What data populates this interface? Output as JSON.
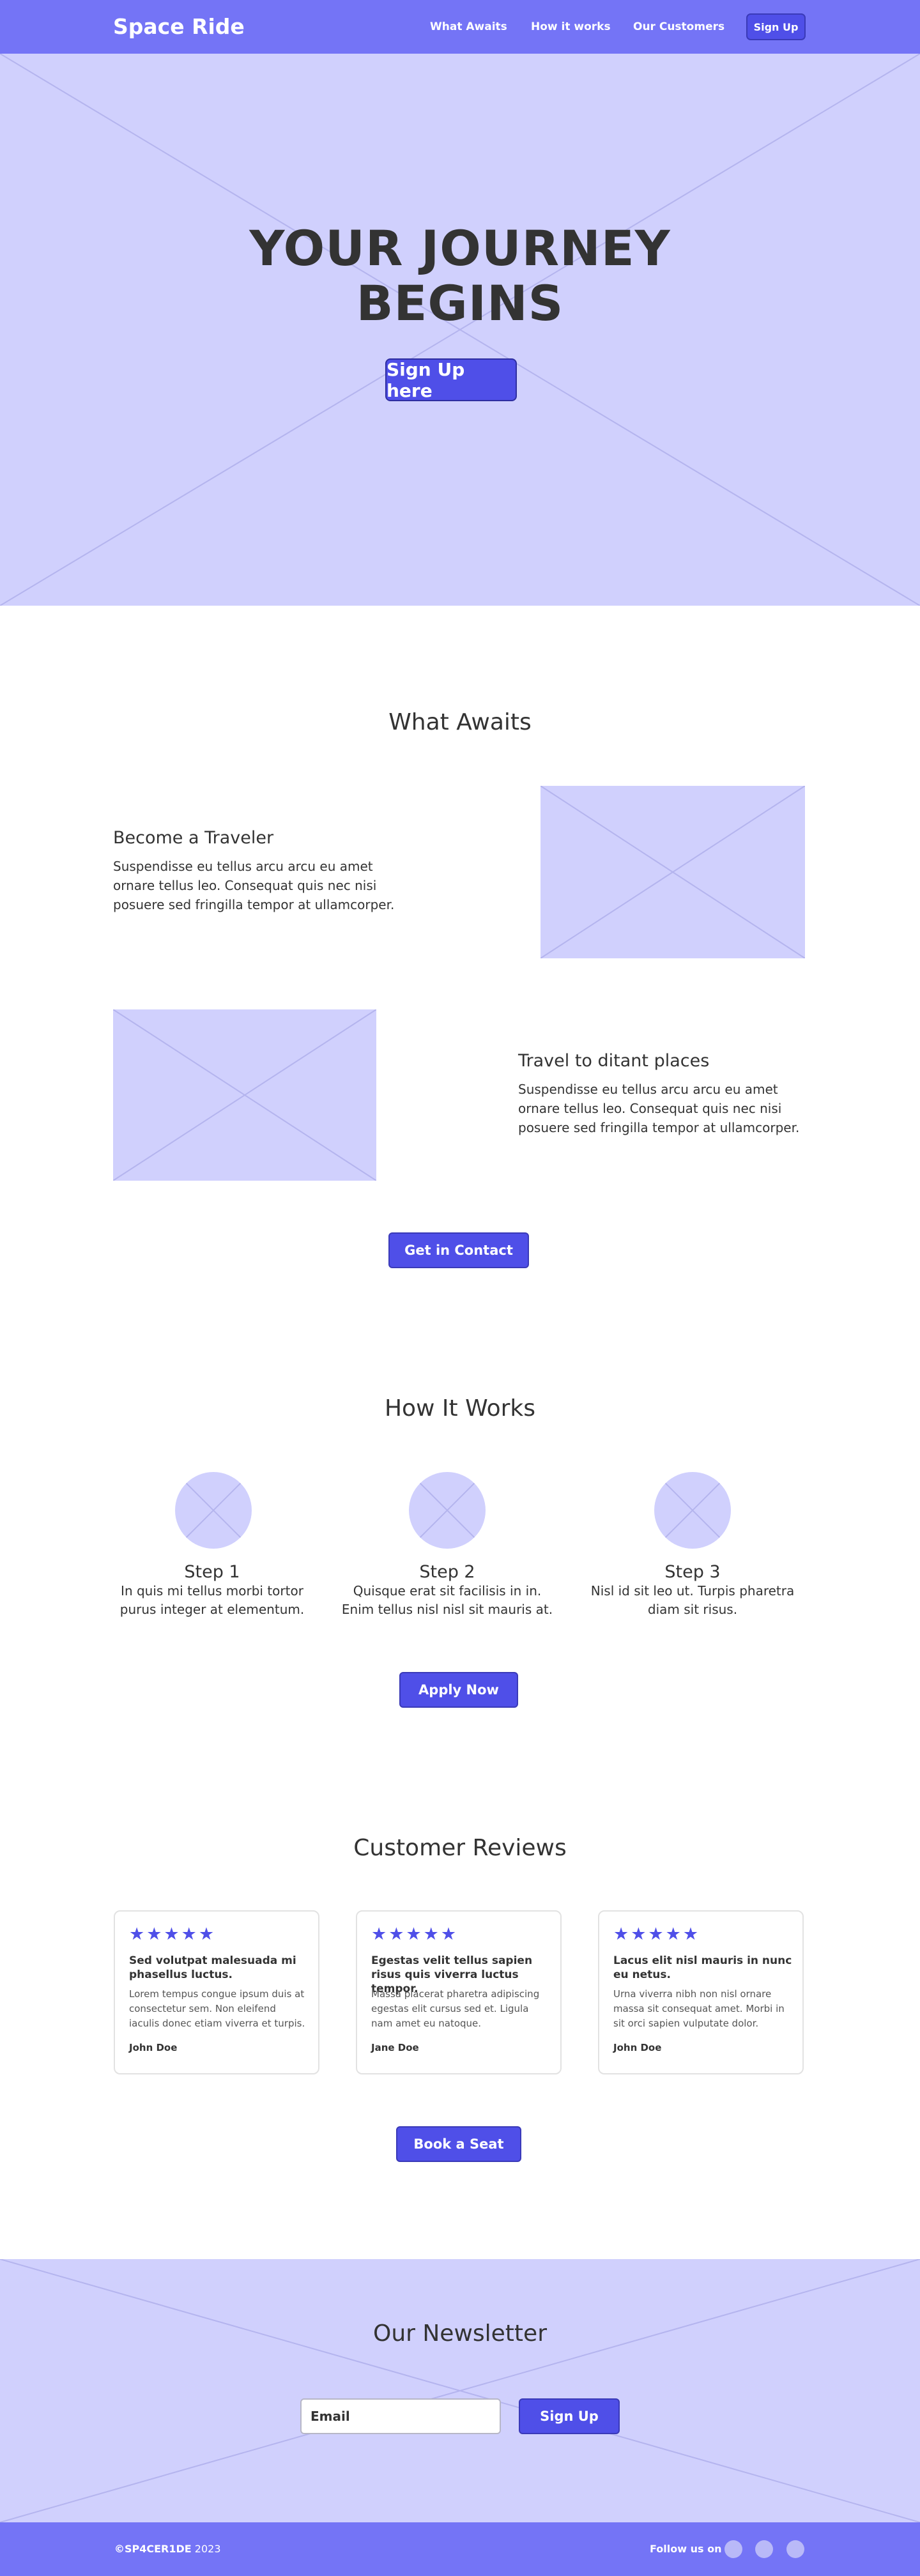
{
  "colors": {
    "nav_bg": "#7474f6",
    "accent": "#4f4fe8",
    "placeholder_bg": "#d0d0fd",
    "text": "#333333",
    "star": "#4f4fe8"
  },
  "nav": {
    "brand": "Space Ride",
    "links": [
      "What Awaits",
      "How it works",
      "Our Customers"
    ],
    "signup_label": "Sign Up"
  },
  "hero": {
    "title_line1": "YOUR JOURNEY",
    "title_line2": "BEGINS",
    "button_label": "Sign Up here"
  },
  "what_awaits": {
    "title": "What Awaits",
    "features": [
      {
        "heading": "Become a  Traveler",
        "body": "Suspendisse eu tellus arcu arcu eu amet ornare tellus leo. Consequat quis nec nisi posuere sed fringilla tempor at ullamcorper."
      },
      {
        "heading": "Travel to ditant places",
        "body": "Suspendisse eu tellus arcu arcu eu amet ornare tellus leo. Consequat quis nec nisi posuere sed fringilla tempor at ullamcorper."
      }
    ],
    "button_label": "Get in Contact"
  },
  "how_it_works": {
    "title": "How It Works",
    "steps": [
      {
        "title": "Step 1",
        "body": "In quis mi tellus morbi tortor purus integer at elementum."
      },
      {
        "title": "Step 2",
        "body": "Quisque erat sit facilisis in in. Enim tellus nisl nisl sit mauris at."
      },
      {
        "title": "Step 3",
        "body": "Nisl id sit leo ut. Turpis pharetra diam sit risus."
      }
    ],
    "button_label": "Apply Now"
  },
  "reviews": {
    "title": "Customer Reviews",
    "items": [
      {
        "stars": 5,
        "stars_text": "★★★★★",
        "title": "Sed volutpat malesuada mi phasellus luctus.",
        "body": "Lorem tempus congue ipsum duis at consectetur sem. Non eleifend iaculis donec etiam viverra et turpis.",
        "author": "John Doe"
      },
      {
        "stars": 5,
        "stars_text": "★★★★★",
        "title": "Egestas velit tellus sapien risus quis viverra luctus tempor.",
        "body": "Massa placerat pharetra adipiscing egestas elit cursus sed et. Ligula nam amet eu natoque.",
        "author": "Jane Doe"
      },
      {
        "stars": 5,
        "stars_text": "★★★★★",
        "title": "Lacus elit nisl mauris in nunc eu netus.",
        "body": "Urna viverra nibh non nisl ornare massa sit consequat amet. Morbi in sit orci sapien vulputate dolor.",
        "author": "John Doe"
      }
    ],
    "button_label": "Book a Seat"
  },
  "newsletter": {
    "title": "Our Newsletter",
    "email_placeholder": "Email",
    "button_label": "Sign Up"
  },
  "footer": {
    "brand": "©SP4CER1DE",
    "year": " 2023",
    "follow_label": "Follow us on",
    "social_icons": [
      "social-icon",
      "social-icon",
      "social-icon"
    ]
  }
}
